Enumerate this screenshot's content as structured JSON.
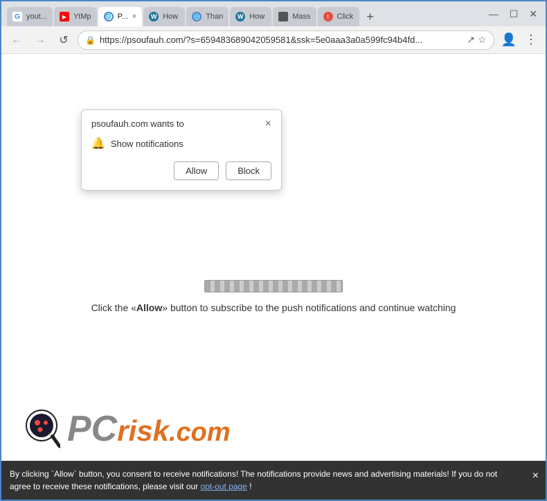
{
  "browser": {
    "tabs": [
      {
        "id": "tab-youtube",
        "label": "yout...",
        "favicon_type": "g",
        "active": false
      },
      {
        "id": "tab-ytmp",
        "label": "YtMp",
        "favicon_type": "yt",
        "active": false
      },
      {
        "id": "tab-p",
        "label": "P...",
        "favicon_type": "globe",
        "active": true,
        "closeable": true
      },
      {
        "id": "tab-how1",
        "label": "How",
        "favicon_type": "wp",
        "active": false
      },
      {
        "id": "tab-than",
        "label": "Than",
        "favicon_type": "globe",
        "active": false
      },
      {
        "id": "tab-how2",
        "label": "How",
        "favicon_type": "wp",
        "active": false
      },
      {
        "id": "tab-mass",
        "label": "Mass",
        "favicon_type": "dot",
        "active": false
      },
      {
        "id": "tab-click",
        "label": "Click",
        "favicon_type": "red-circle",
        "active": false
      }
    ],
    "new_tab_label": "+",
    "window_controls": {
      "minimize": "—",
      "maximize": "☐",
      "close": "✕"
    },
    "nav": {
      "back": "←",
      "forward": "→",
      "refresh": "↺",
      "url": "https://psoufauh.com/?s=659483689042059581&ssk=5e0aaa3a0a599fc94b4fd...",
      "bookmark": "☆",
      "profile": "👤",
      "menu": "⋮"
    }
  },
  "notification_popup": {
    "title": "psoufauh.com wants to",
    "close_button": "×",
    "bell_icon": "🔔",
    "subtitle": "Show notifications",
    "allow_button": "Allow",
    "block_button": "Block"
  },
  "page": {
    "progress_text": "Click the «Allow» button to subscribe to the push notifications and continue watching",
    "allow_text": "Allow"
  },
  "bottom_bar": {
    "text": "By clicking `Allow` button, you consent to receive notifications! The notifications provide news and advertising materials! If you do not agree to receive these notifications, please visit our ",
    "link_text": "opt-out page",
    "text_end": "!",
    "close": "×"
  },
  "logo": {
    "pc_text": "PC",
    "risk_text": "risk",
    "com_text": ".com"
  }
}
